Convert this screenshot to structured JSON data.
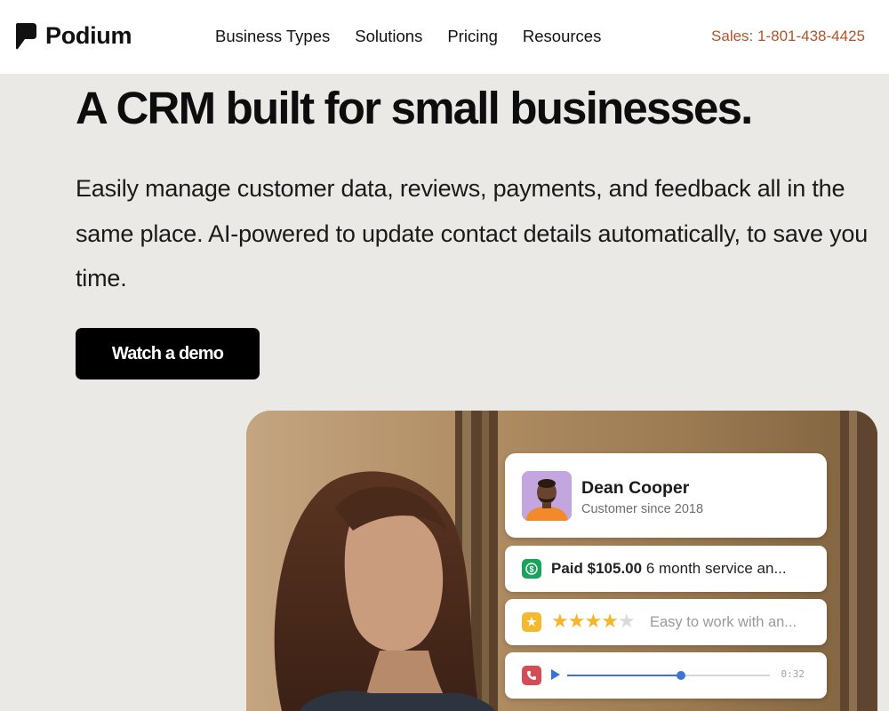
{
  "header": {
    "brand": "Podium",
    "nav": [
      "Business Types",
      "Solutions",
      "Pricing",
      "Resources"
    ],
    "sales": "Sales: 1-801-438-4425"
  },
  "hero": {
    "title": "A CRM built for small businesses.",
    "subtitle": "Easily manage customer data, reviews, payments, and feedback all in the same place. AI-powered to update contact details automatically, to save you time.",
    "cta": "Watch a demo"
  },
  "profile": {
    "name": "Dean Cooper",
    "since": "Customer since 2018"
  },
  "payment": {
    "icon": "dollar-icon",
    "label": "Paid",
    "amount": "$105.00",
    "detail": "6 month service an..."
  },
  "review": {
    "icon": "star-icon",
    "rating": 4,
    "max": 5,
    "text": "Easy to work with an..."
  },
  "call": {
    "icon": "phone-icon",
    "progress": 0.56,
    "time": "0:32"
  },
  "colors": {
    "background": "#ebe9e6",
    "sales_accent": "#b4532a",
    "pay_green": "#1aa35a",
    "star_yellow": "#f4b62b",
    "call_red": "#d64c55",
    "audio_blue": "#3d72d8"
  }
}
